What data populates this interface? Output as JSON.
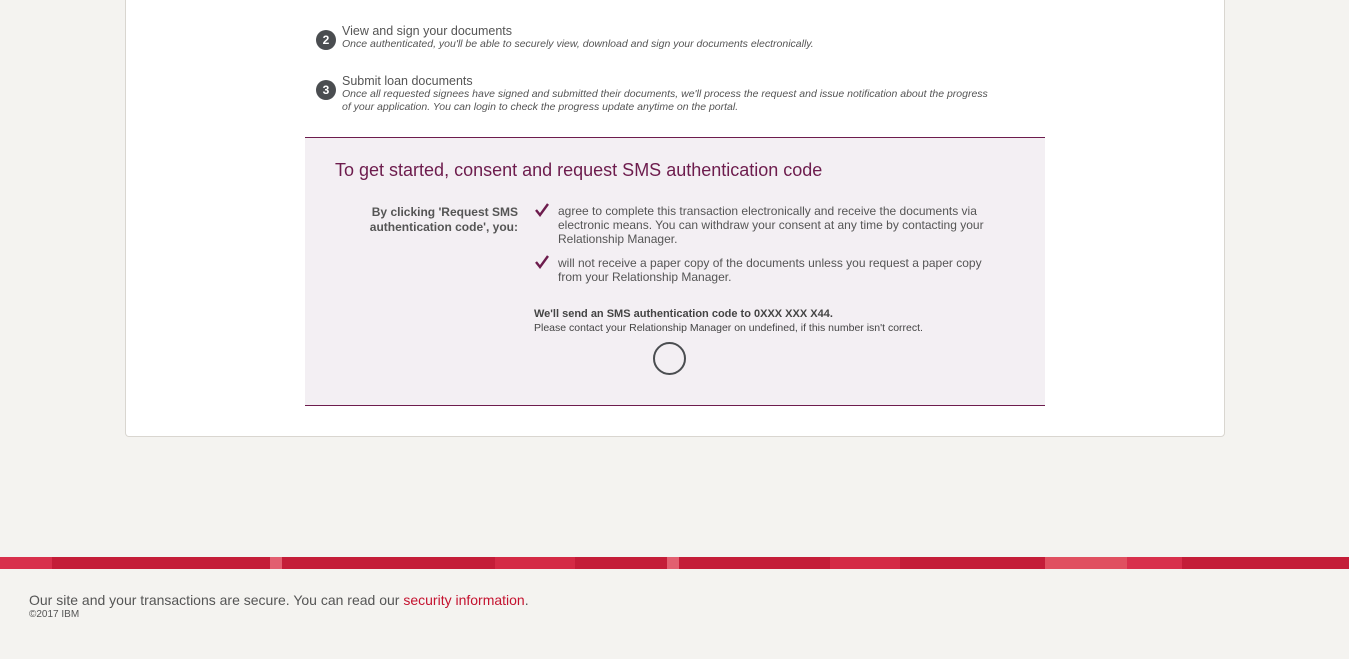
{
  "steps": [
    {
      "number": "2",
      "title": "View and sign your documents",
      "description": "Once authenticated, you'll be able to securely view, download and sign your documents electronically."
    },
    {
      "number": "3",
      "title": "Submit loan documents",
      "description": "Once all requested signees have signed and submitted their documents, we'll process the request and issue notification about the progress of your application. You can login to check the progress update anytime on the portal."
    }
  ],
  "consent": {
    "heading": "To get started, consent and request SMS authentication code",
    "lead": "By clicking 'Request SMS authentication code', you:",
    "items": [
      "agree to complete this transaction electronically and receive the documents via electronic means. You can withdraw your consent at any time by contacting your Relationship Manager.",
      "will not receive a paper copy of the documents unless you request a paper copy from your Relationship Manager."
    ],
    "sms_notice": "We'll send an SMS authentication code to 0XXX XXX X44.",
    "sms_help": "Please contact your Relationship Manager on undefined, if this number isn't correct."
  },
  "footer": {
    "secure_text": "Our site and your transactions are secure. You can read our ",
    "security_link": "security information",
    "secure_end": ".",
    "copyright": "©2017 IBM"
  },
  "colors": {
    "accent": "#6d1c4d",
    "stripe": "#c41d38",
    "link": "#c4122f",
    "step_badge": "#4a4d50"
  }
}
